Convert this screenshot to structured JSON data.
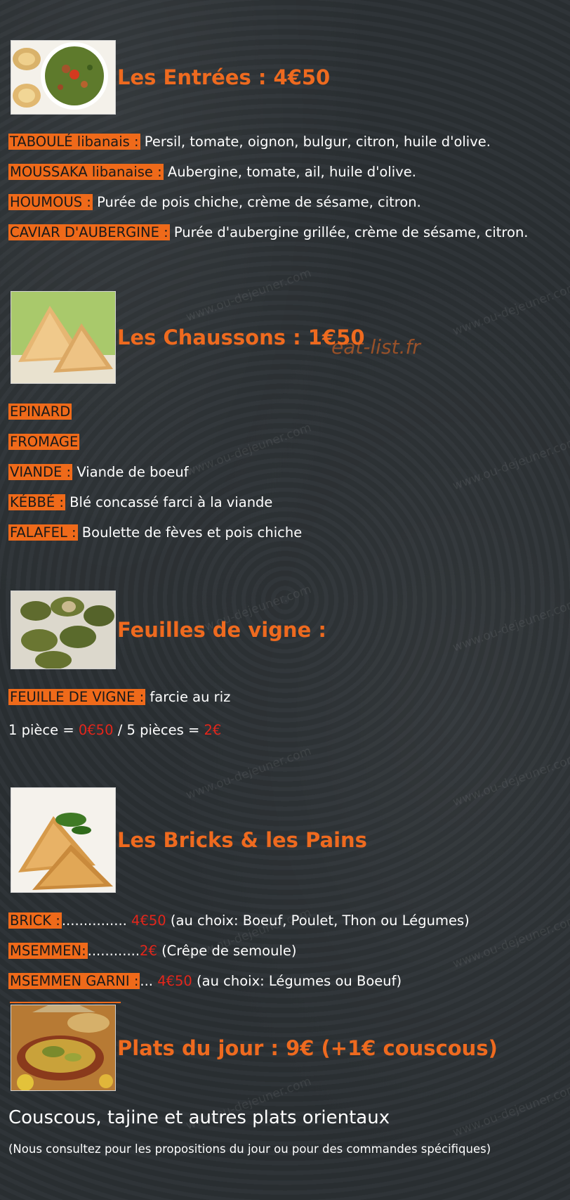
{
  "watermark": "www.ou-dejeuner.com",
  "overlay_watermark": "eat-list.fr",
  "sections": {
    "entrees": {
      "title": "Les Entrées : 4€50",
      "items": [
        {
          "name": "TABOULÉ libanais :",
          "desc": " Persil, tomate, oignon, bulgur, citron, huile d'olive."
        },
        {
          "name": "MOUSSAKA libanaise :",
          "desc": " Aubergine, tomate, ail, huile d'olive."
        },
        {
          "name": "HOUMOUS :",
          "desc": " Purée de pois chiche, crème de sésame, citron."
        },
        {
          "name": "CAVIAR D'AUBERGINE :",
          "desc": " Purée d'aubergine grillée, crème de sésame, citron."
        }
      ]
    },
    "chaussons": {
      "title": "Les Chaussons : 1€50",
      "items": [
        {
          "name": "EPINARD",
          "desc": ""
        },
        {
          "name": "FROMAGE",
          "desc": ""
        },
        {
          "name": "VIANDE :",
          "desc": " Viande de boeuf"
        },
        {
          "name": "KÉBBÉ :",
          "desc": " Blé concassé farci à la viande"
        },
        {
          "name": "FALAFEL :",
          "desc": " Boulette de fèves et pois chiche"
        }
      ]
    },
    "feuilles": {
      "title": "Feuilles de vigne :",
      "item": {
        "name": "FEUILLE DE VIGNE :",
        "desc": " farcie au riz"
      },
      "price_line": {
        "a": "1 pièce = ",
        "p1": "0€50",
        "b": " / 5 pièces = ",
        "p2": "2€"
      }
    },
    "bricks": {
      "title": "Les Bricks & les Pains",
      "items": [
        {
          "name": "BRICK :",
          "dots": "............... ",
          "price": "4€50",
          "desc": " (au choix: Boeuf, Poulet, Thon ou Légumes)"
        },
        {
          "name": "MSEMMEN:",
          "dots": "............",
          "price": "2€",
          "desc": " (Crêpe de semoule)"
        },
        {
          "name": "MSEMMEN GARNI :",
          "dots": "... ",
          "price": "4€50",
          "desc": " (au choix: Légumes ou Boeuf)"
        }
      ]
    },
    "plats": {
      "title": "Plats du jour : 9€ (+1€ couscous)",
      "subtitle": "Couscous, tajine et autres plats orientaux",
      "note": "(Nous consultez pour les propositions du jour ou pour des commandes spécifiques)"
    }
  },
  "colors": {
    "accent": "#ef6a1a",
    "price_red": "#e3261b",
    "background": "#2a2f33"
  }
}
